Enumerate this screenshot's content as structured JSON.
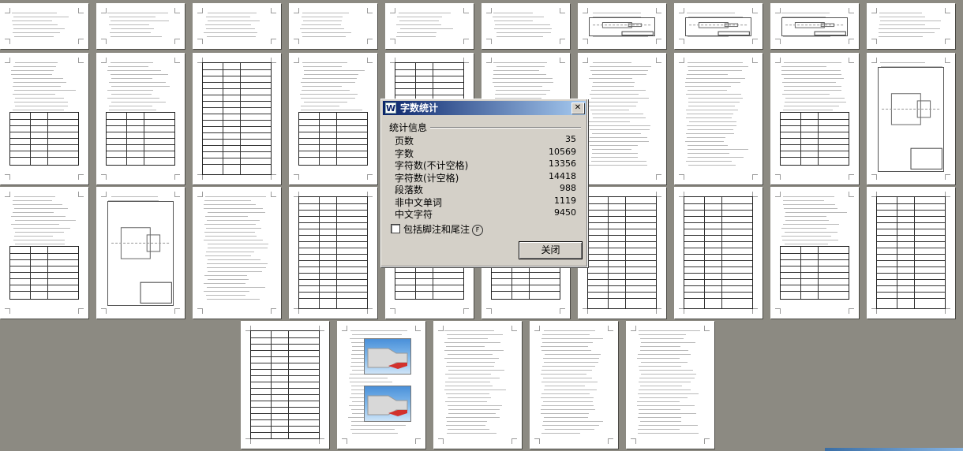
{
  "dialog": {
    "title": "字数统计",
    "app_icon_glyph": "W",
    "close_glyph": "✕",
    "section_label": "统计信息",
    "stats": [
      {
        "label": "页数",
        "value": "35"
      },
      {
        "label": "字数",
        "value": "10569"
      },
      {
        "label": "字符数(不计空格)",
        "value": "13356"
      },
      {
        "label": "字符数(计空格)",
        "value": "14418"
      },
      {
        "label": "段落数",
        "value": "988"
      },
      {
        "label": "非中文单词",
        "value": "1119"
      },
      {
        "label": "中文字符",
        "value": "9450"
      }
    ],
    "checkbox_label": "包括脚注和尾注",
    "checkbox_key": "F",
    "checkbox_checked": false,
    "close_button": "关闭"
  },
  "document": {
    "page_count_visible": 35
  }
}
